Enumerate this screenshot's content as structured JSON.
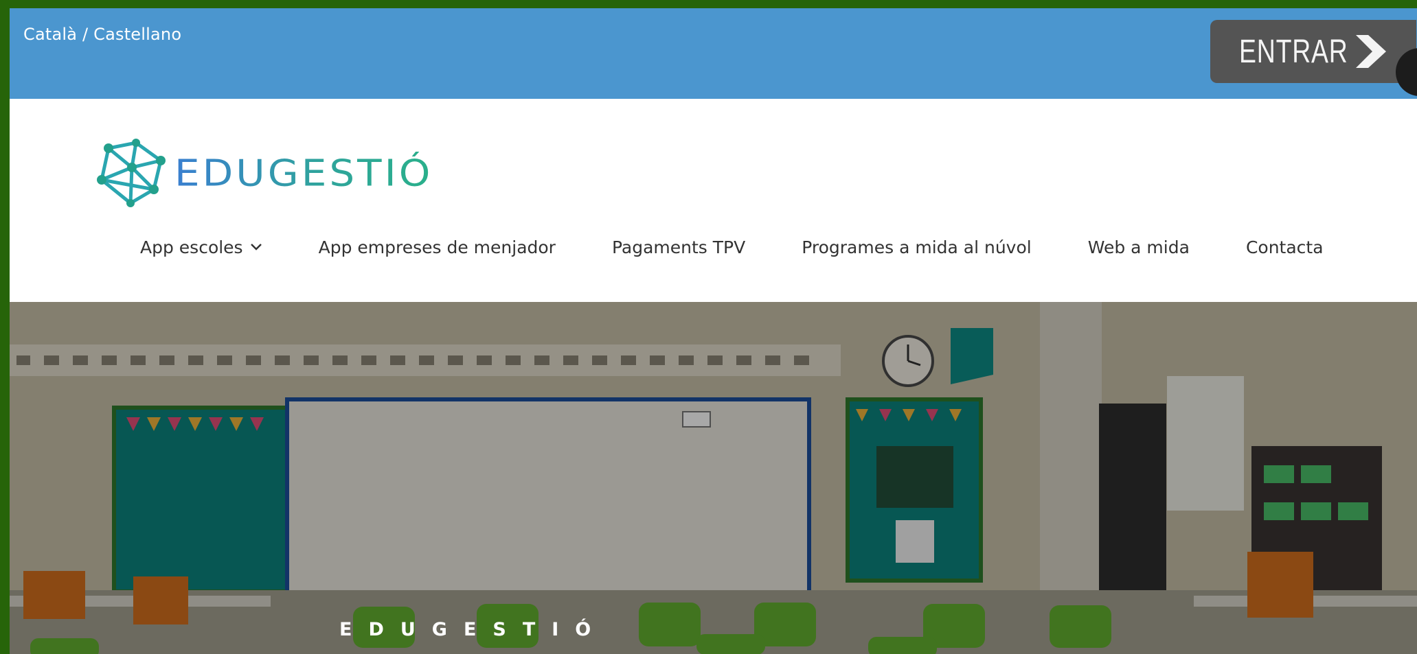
{
  "topbar": {
    "language": {
      "catalan": "Català",
      "separator": " / ",
      "spanish": "Castellano"
    },
    "login_label": "ENTRAR"
  },
  "header": {
    "logo_text": "EDUGESTIÓ",
    "nav": [
      {
        "label": "App escoles",
        "has_dropdown": true
      },
      {
        "label": "App empreses de menjador",
        "has_dropdown": false
      },
      {
        "label": "Pagaments TPV",
        "has_dropdown": false
      },
      {
        "label": "Programes a mida al núvol",
        "has_dropdown": false
      },
      {
        "label": "Web a mida",
        "has_dropdown": false
      },
      {
        "label": "Contacta",
        "has_dropdown": false
      }
    ]
  },
  "hero": {
    "title": "EDUGESTIÓ",
    "image": "classroom-photo"
  },
  "colors": {
    "topbar": "#4b96cf",
    "login_button": "#545454",
    "page_frame": "#266409",
    "logo_blue": "#3a7fd0",
    "logo_teal": "#2ab08a"
  }
}
